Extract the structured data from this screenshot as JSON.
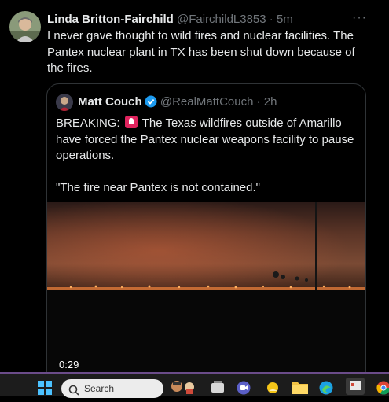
{
  "tweet": {
    "author_name": "Linda Britton-Fairchild",
    "author_handle": "@FairchildL3853",
    "separator": "·",
    "time": "5m",
    "more_label": "···",
    "text": "I never gave thought to wild fires and nuclear facilities. The Pantex nuclear plant in TX has been shut down because of the fires."
  },
  "quoted_tweet": {
    "author_name": "Matt Couch",
    "author_handle": "@RealMattCouch",
    "separator": "·",
    "time": "2h",
    "verified_icon": "verified-badge-icon",
    "text_breaking_prefix": "BREAKING:",
    "text_line1": "The Texas wildfires outside of Amarillo have forced the Pantex nuclear weapons facility to pause operations.",
    "text_line2": "\"The fire near Pantex is not contained.\"",
    "video_duration": "0:29"
  },
  "taskbar": {
    "search_placeholder": "Search",
    "icons": [
      "start-icon",
      "search-icon",
      "widgets-icon",
      "task-view-icon",
      "video-app-icon",
      "weather-icon",
      "file-explorer-icon",
      "edge-icon",
      "photos-icon",
      "chrome-icon"
    ]
  },
  "colors": {
    "background": "#000000",
    "text_primary": "#e7e9ea",
    "text_secondary": "#71767b",
    "verified": "#1d9bf0",
    "siren": "#e0245e",
    "taskbar_accent": "#6b4c8a"
  }
}
